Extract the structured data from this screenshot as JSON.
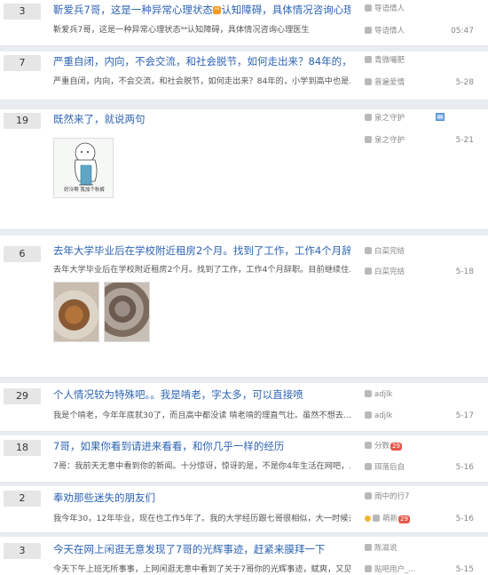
{
  "threads": [
    {
      "reply_count": "3",
      "title": "靳爱兵7哥，这是一种异常心理状态",
      "title_tag": "ᵃᵃ",
      "title_rest": "认知障碍，具体情况咨询心理",
      "abstract": "靳爱兵7哥，这是一种异常心理状态ᵃᵃ认知障碍，具体情况咨询心理医生",
      "author": "导语情人",
      "last_reply_user": "导语情人",
      "time": "05:47"
    },
    {
      "reply_count": "7",
      "title": "严重自闭，内向，不会交流，和社会脱节，如何走出来？84年的，",
      "abstract": "严重自闭，内向，不会交流，和社会脱节，如何走出来？84年的，小学到高中也是...",
      "author": "青微嘬肥",
      "last_reply_user": "普遍爱情",
      "time": "5-28"
    },
    {
      "reply_count": "19",
      "title": "既然来了，就说两句",
      "abstract": "",
      "author": "泉之守护",
      "last_reply_user": "泉之守护",
      "time": "5-21",
      "image_caption": "好冷啊 我加个秋裤"
    },
    {
      "reply_count": "6",
      "title": "去年大学毕业后在学校附近租房2个月。找到了工作，工作4个月辞",
      "abstract": "去年大学毕业后在学校附近租房2个月。找到了工作，工作4个月辞职。目前继续住...",
      "author": "白菜完结",
      "last_reply_user": "白菜完结",
      "time": "5-18"
    },
    {
      "reply_count": "29",
      "title": "个人情况较为特殊吧。。我是啃老，字太多，可以直接喷",
      "abstract": "我是个啃老，今年年底就30了，而且高中都没读 啃老啃的理直气壮。虽然不想去...",
      "author": "adjlk",
      "last_reply_user": "adjlk",
      "time": "5-17"
    },
    {
      "reply_count": "18",
      "title": "7哥，如果你看到请进来看看，和你几乎一样的经历",
      "abstract": "7哥：我前天无意中看到你的新闻。十分惊讶，惊讶的是，不是你4年生活在网吧，...",
      "author": "分数",
      "author_badge": "29",
      "last_reply_user": "珥落后自",
      "time": "5-16"
    },
    {
      "reply_count": "2",
      "title": "奉劝那些迷失的朋友们",
      "abstract": "我今年30，12年毕业，现在也工作5年了。我的大学经历跟七哥很相似，大一时候去...",
      "author": "雨中的行7",
      "last_reply_user": "萌新",
      "last_reply_badge": "29",
      "time": "5-16"
    },
    {
      "reply_count": "3",
      "title": "今天在网上闲逛无意发现了7哥的光辉事迹，赶紧来膜拜一下",
      "abstract": "今天下午上班无所事事，上网闲逛无意中看到了关于7哥你的光辉事迹，赋爽，又见...",
      "author": "陈滋说",
      "last_reply_user": "贴吧用户_...",
      "time": "5-15"
    }
  ]
}
